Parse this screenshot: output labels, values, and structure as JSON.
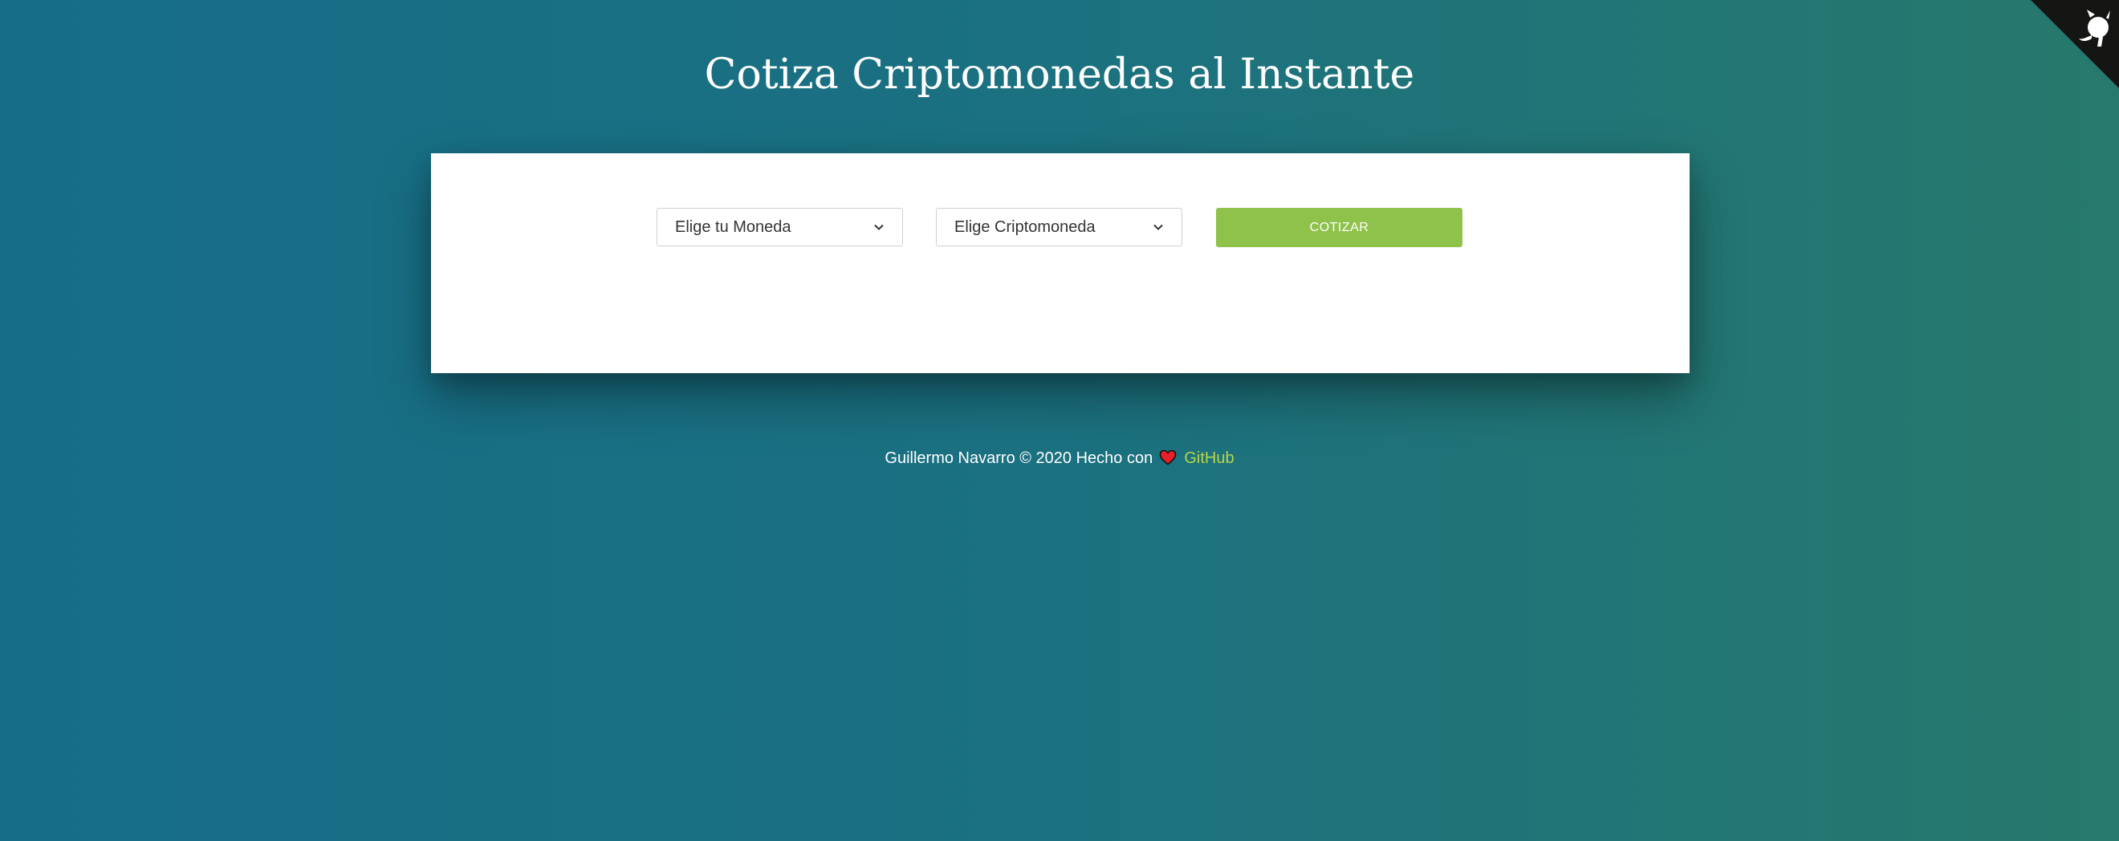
{
  "header": {
    "title": "Cotiza Criptomonedas al Instante"
  },
  "form": {
    "currency_select": {
      "selected": "Elige tu Moneda"
    },
    "crypto_select": {
      "selected": "Elige Criptomoneda"
    },
    "submit_label": "COTIZAR"
  },
  "footer": {
    "text": "Guillermo Navarro © 2020 Hecho con",
    "heart_icon": "heart-icon",
    "link_label": "GitHub"
  },
  "corner": {
    "icon": "github-octocat-icon"
  },
  "colors": {
    "background_start": "#166d88",
    "background_end": "#27796c",
    "button": "#8fc24b",
    "link": "#b9d64c",
    "corner": "#151513"
  }
}
